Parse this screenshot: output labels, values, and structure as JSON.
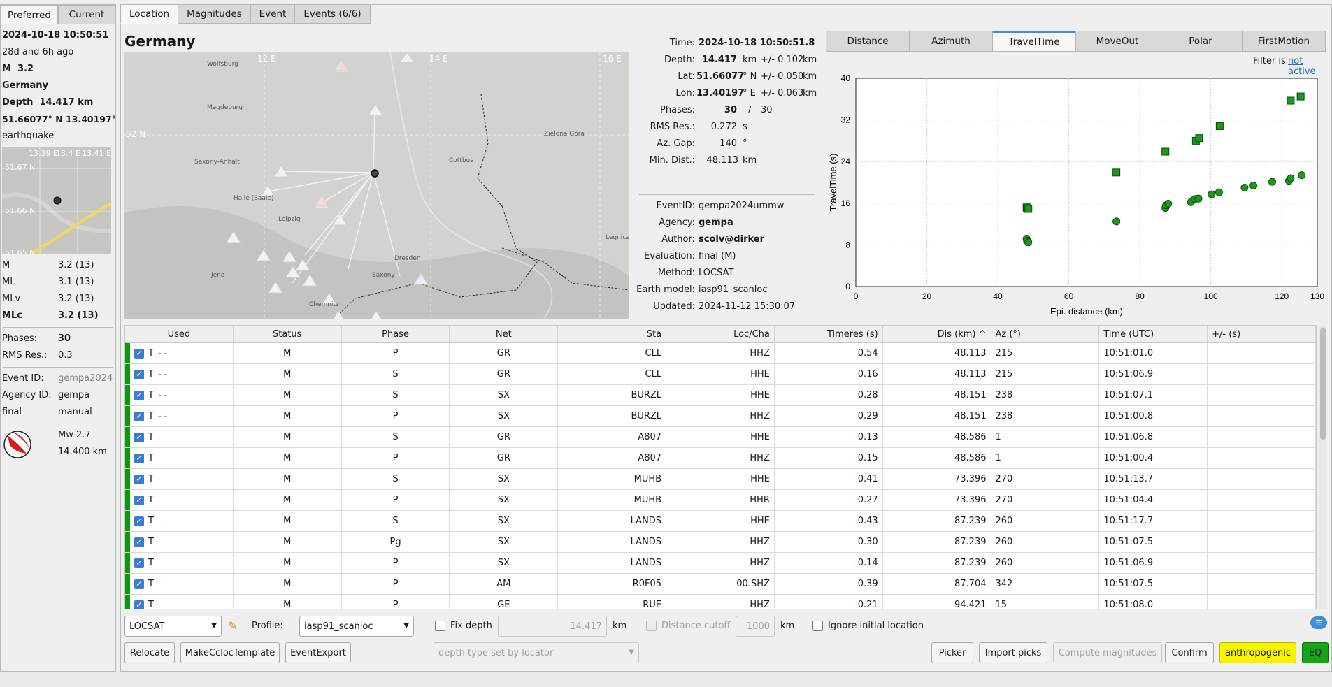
{
  "left": {
    "tabs": [
      "Preferred",
      "Current"
    ],
    "time": "2024-10-18 10:50:51",
    "ago": "28d and 6h ago",
    "mag_label": "M",
    "mag_value": "3.2",
    "region": "Germany",
    "depth_label": "Depth",
    "depth_value": "14.417 km",
    "coords": "51.66077° N  13.40197° E",
    "type": "earthquake",
    "minimap": {
      "lon_ticks": [
        "13.39 E",
        "13.4 E",
        "13.41 E"
      ],
      "lat_ticks": [
        "51.67 N",
        "51.66 N",
        "51.65 N"
      ]
    },
    "magnitudes": [
      {
        "type": "M",
        "value": "3.2 (13)"
      },
      {
        "type": "ML",
        "value": "3.1 (13)"
      },
      {
        "type": "MLv",
        "value": "3.2 (13)"
      },
      {
        "type": "MLc",
        "value": "3.2 (13)"
      }
    ],
    "phases_label": "Phases:",
    "phases_value": "30",
    "rms_label": "RMS Res.:",
    "rms_value": "0.3",
    "eventid_label": "Event ID:",
    "eventid_value": "gempa2024",
    "agency_label": "Agency ID:",
    "agency_value": "gempa",
    "eval_status": "final",
    "eval_mode": "manual",
    "fm_mw": "Mw 2.7",
    "fm_depth": "14.400 km"
  },
  "tabs": [
    "Location",
    "Magnitudes",
    "Event",
    "Events (6/6)"
  ],
  "region_title": "Germany",
  "map": {
    "lon_labels": [
      "12 E",
      "14 E",
      "16 E"
    ],
    "lat_label": "52 N",
    "places": [
      "Wolfsburg",
      "Magdeburg",
      "Saxony-Anhalt",
      "Halle (Saale)",
      "Leipzig",
      "Jena",
      "Chemnitz",
      "Dresden",
      "Saxony",
      "Cottbus",
      "Zielona Góra",
      "Legnica"
    ]
  },
  "origin": {
    "time_label": "Time:",
    "time": "2024-10-18 10:50:51.8",
    "depth_label": "Depth:",
    "depth": "14.417",
    "depth_unit": "km",
    "depth_err": "+/- 0.102",
    "depth_err_unit": "km",
    "lat_label": "Lat:",
    "lat": "51.66077",
    "lat_unit": "° N",
    "lat_err": "+/- 0.050",
    "lat_err_unit": "km",
    "lon_label": "Lon:",
    "lon": "13.40197",
    "lon_unit": "° E",
    "lon_err": "+/- 0.063",
    "lon_err_unit": "km",
    "phases_label": "Phases:",
    "phases_used": "30",
    "phases_sep": "/",
    "phases_total": "30",
    "rms_label": "RMS Res.:",
    "rms": "0.272",
    "rms_unit": "s",
    "azgap_label": "Az. Gap:",
    "azgap": "140",
    "azgap_unit": "°",
    "mindist_label": "Min. Dist.:",
    "mindist": "48.113",
    "mindist_unit": "km",
    "eventid_label": "EventID:",
    "eventid": "gempa2024ummw",
    "agency_label": "Agency:",
    "agency": "gempa",
    "author_label": "Author:",
    "author": "scolv@dirker",
    "evaluation_label": "Evaluation:",
    "evaluation": "final (M)",
    "method_label": "Method:",
    "method": "LOCSAT",
    "earthmodel_label": "Earth model:",
    "earthmodel": "iasp91_scanloc",
    "updated_label": "Updated:",
    "updated": "2024-11-12 15:30:07"
  },
  "plot_tabs": [
    "Distance",
    "Azimuth",
    "TravelTime",
    "MoveOut",
    "Polar",
    "FirstMotion"
  ],
  "filter_label": "Filter is",
  "filter_link": "not active",
  "chart_data": {
    "type": "scatter",
    "xlabel": "Epi. distance (km)",
    "ylabel": "TravelTime (s)",
    "xlim": [
      0,
      130
    ],
    "ylim": [
      0,
      40
    ],
    "xticks": [
      0,
      20,
      40,
      60,
      80,
      100,
      120,
      130
    ],
    "yticks": [
      0,
      8,
      16,
      24,
      32,
      40
    ],
    "grid": true,
    "series": [
      {
        "marker": "square",
        "x": [
          48.1,
          48.2,
          48.6,
          73.4,
          87.2,
          95.8,
          96.7,
          102.5,
          122.5,
          125.3
        ],
        "y": [
          15.2,
          15.0,
          14.9,
          21.9,
          25.9,
          28.0,
          28.5,
          30.8,
          35.7,
          36.5
        ]
      },
      {
        "marker": "circle",
        "x": [
          48.1,
          48.2,
          48.6,
          73.4,
          87.2,
          87.4,
          88.0,
          94.4,
          95.5,
          96.5,
          100.2,
          102.3,
          109.5,
          112.0,
          117.3,
          122.0,
          122.5,
          125.6
        ],
        "y": [
          9.2,
          8.8,
          8.5,
          12.5,
          15.1,
          15.6,
          15.9,
          16.2,
          16.8,
          16.9,
          17.7,
          18.1,
          19.0,
          19.4,
          20.1,
          20.3,
          20.8,
          21.4
        ]
      }
    ]
  },
  "table": {
    "headers": [
      "Used",
      "Status",
      "Phase",
      "Net",
      "Sta",
      "Loc/Cha",
      "Timeres (s)",
      "Dis (km) ^",
      "Az (°)",
      "Time (UTC)",
      "+/- (s)"
    ],
    "rows": [
      [
        "T",
        "M",
        "P",
        "GR",
        "CLL",
        "HHZ",
        "0.54",
        "48.113",
        "215",
        "10:51:01.0",
        ""
      ],
      [
        "T",
        "M",
        "S",
        "GR",
        "CLL",
        "HHE",
        "0.16",
        "48.113",
        "215",
        "10:51:06.9",
        ""
      ],
      [
        "T",
        "M",
        "S",
        "SX",
        "BURZL",
        "HHE",
        "0.28",
        "48.151",
        "238",
        "10:51:07.1",
        ""
      ],
      [
        "T",
        "M",
        "P",
        "SX",
        "BURZL",
        "HHZ",
        "0.29",
        "48.151",
        "238",
        "10:51:00.8",
        ""
      ],
      [
        "T",
        "M",
        "S",
        "GR",
        "A807",
        "HHE",
        "-0.13",
        "48.586",
        "1",
        "10:51:06.8",
        ""
      ],
      [
        "T",
        "M",
        "P",
        "GR",
        "A807",
        "HHZ",
        "-0.15",
        "48.586",
        "1",
        "10:51:00.4",
        ""
      ],
      [
        "T",
        "M",
        "S",
        "SX",
        "MUHB",
        "HHE",
        "-0.41",
        "73.396",
        "270",
        "10:51:13.7",
        ""
      ],
      [
        "T",
        "M",
        "P",
        "SX",
        "MUHB",
        "HHR",
        "-0.27",
        "73.396",
        "270",
        "10:51:04.4",
        ""
      ],
      [
        "T",
        "M",
        "S",
        "SX",
        "LANDS",
        "HHE",
        "-0.43",
        "87.239",
        "260",
        "10:51:17.7",
        ""
      ],
      [
        "T",
        "M",
        "Pg",
        "SX",
        "LANDS",
        "HHZ",
        "0.30",
        "87.239",
        "260",
        "10:51:07.5",
        ""
      ],
      [
        "T",
        "M",
        "P",
        "SX",
        "LANDS",
        "HHZ",
        "-0.14",
        "87.239",
        "260",
        "10:51:06.9",
        ""
      ],
      [
        "T",
        "M",
        "P",
        "AM",
        "R0F05",
        "00.SHZ",
        "0.39",
        "87.704",
        "342",
        "10:51:07.5",
        ""
      ],
      [
        "T",
        "M",
        "P",
        "GE",
        "RUE",
        "HHZ",
        "-0.21",
        "94.421",
        "15",
        "10:51:08.0",
        ""
      ]
    ],
    "used_dashes": "- -"
  },
  "controls": {
    "locator": "LOCSAT",
    "profile_label": "Profile:",
    "profile": "iasp91_scanloc",
    "fix_depth_label": "Fix depth",
    "fix_depth_value": "14.417",
    "fix_depth_unit": "km",
    "distance_cutoff_label": "Distance cutoff",
    "distance_cutoff_value": "1000",
    "distance_cutoff_unit": "km",
    "ignore_initial_label": "Ignore initial location",
    "depth_type": "depth type set by locator",
    "buttons": {
      "relocate": "Relocate",
      "make_template": "MakeCclocTemplate",
      "export": "EventExport",
      "picker": "Picker",
      "import": "Import picks",
      "compute": "Compute magnitudes",
      "confirm": "Confirm",
      "anthropogenic": "anthropogenic",
      "eq": "EQ"
    }
  },
  "colors": {
    "green": "#0a9a0a",
    "plot_green": "#1d9a1d",
    "link": "#2a6ac0",
    "tab_accent": "#3d8fd9",
    "yellow": "#f5f500",
    "eq_green": "#19a319"
  }
}
